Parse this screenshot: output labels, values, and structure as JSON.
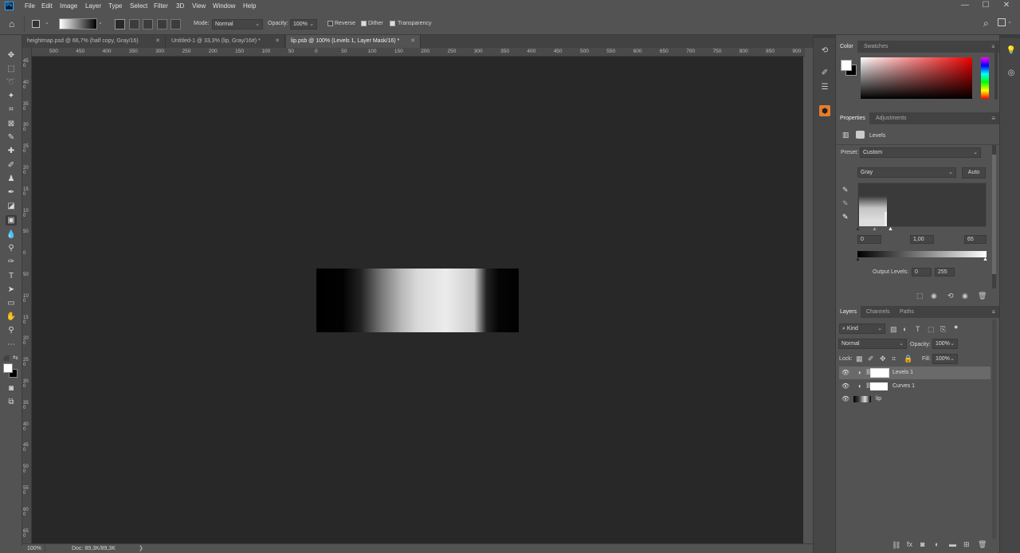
{
  "menubar": {
    "logo": "Ps",
    "items": [
      "File",
      "Edit",
      "Image",
      "Layer",
      "Type",
      "Select",
      "Filter",
      "3D",
      "View",
      "Window",
      "Help"
    ],
    "window_controls": [
      "—",
      "☐",
      "✕"
    ]
  },
  "options": {
    "mode_label": "Mode:",
    "mode_value": "Normal",
    "opacity_label": "Opacity:",
    "opacity_value": "100%",
    "reverse_label": "Reverse",
    "dither_label": "Dither",
    "transparency_label": "Transparency",
    "reverse_checked": false,
    "dither_checked": true,
    "transparency_checked": true
  },
  "tabs": [
    {
      "label": "heightmap.psd @ 66,7% (half copy, Gray/16)",
      "close": "✕"
    },
    {
      "label": "Untitled-1 @ 33,3% (lip, Gray/16#) *",
      "close": "✕"
    },
    {
      "label": "lip.psb @ 100% (Levels 1, Layer Mask/16) *",
      "close": "✕"
    }
  ],
  "ruler": {
    "top_ticks": [
      "500",
      "450",
      "400",
      "350",
      "300",
      "250",
      "200",
      "150",
      "100",
      "50",
      "0",
      "50",
      "100",
      "150",
      "200",
      "250",
      "300",
      "350",
      "400",
      "450",
      "500",
      "550",
      "600",
      "650",
      "700",
      "750",
      "800",
      "850",
      "900"
    ],
    "left_ticks": [
      "450",
      "400",
      "350",
      "300",
      "250",
      "200",
      "150",
      "100",
      "50",
      "0",
      "50",
      "100",
      "150",
      "200",
      "250",
      "300",
      "350",
      "400",
      "450",
      "500",
      "550",
      "600",
      "650",
      "700"
    ]
  },
  "status": {
    "zoom": "100%",
    "doc": "Doc: 89,3K/89,3K",
    "arrow": "❯"
  },
  "color_panel": {
    "tabs": [
      "Color",
      "Swatches"
    ]
  },
  "properties": {
    "tabs": [
      "Properties",
      "Adjustments"
    ],
    "title": "Levels",
    "preset_label": "Preset:",
    "preset_value": "Custom",
    "channel": "Gray",
    "auto_label": "Auto",
    "input_black": "0",
    "input_gamma": "1,00",
    "input_white": "65",
    "output_label": "Output Levels:",
    "output_black": "0",
    "output_white": "255"
  },
  "layers_panel": {
    "tabs": [
      "Layers",
      "Channels",
      "Paths"
    ],
    "filter_label": "Kind",
    "blend_mode": "Normal",
    "opacity_label": "Opacity:",
    "opacity_value": "100%",
    "lock_label": "Lock:",
    "fill_label": "Fill:",
    "fill_value": "100%",
    "layers": [
      {
        "name": "Levels 1",
        "selected": true
      },
      {
        "name": "Curves 1",
        "selected": false
      },
      {
        "name": "lip",
        "selected": false
      }
    ]
  },
  "colors": {
    "bg": "#535353",
    "canvas": "#282828",
    "accent": "#31a8ff",
    "layer_selected": "#6a6a6a"
  }
}
